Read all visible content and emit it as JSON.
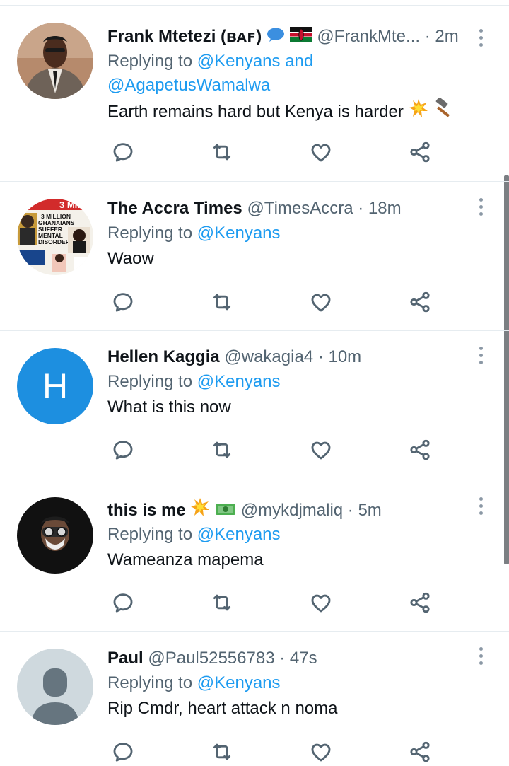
{
  "colors": {
    "link": "#1d9bf0",
    "secondary": "#536471",
    "divider": "#e6ecf0",
    "text": "#0f1419"
  },
  "replying_prefix": "Replying to",
  "tweets": [
    {
      "name": "Frank Mtetezi (ʙᴀꜰ)",
      "handle": "@FrankMte...",
      "time": "· 2m",
      "reply_line1": "@Kenyans and",
      "reply_line2": "@AgapetusWamalwa",
      "text": "Earth remains hard but Kenya is harder",
      "icons": [
        "speech-bubble-emoji",
        "kenya-flag-emoji",
        "collision-emoji",
        "hammer-emoji"
      ]
    },
    {
      "name": "The Accra Times",
      "handle": "@TimesAccra",
      "time": "· 18m",
      "reply": "@Kenyans",
      "text": "Waow",
      "avatar_text": [
        "3 MILLION",
        "GHANAIANS",
        "SUFFER",
        "MENTAL",
        "DISORDER"
      ]
    },
    {
      "name": "Hellen Kaggia",
      "handle": "@wakagia4",
      "time": "· 10m",
      "reply": "@Kenyans",
      "text": "What is this now",
      "avatar_letter": "H"
    },
    {
      "name": "this is me",
      "handle": "@mykdjmaliq",
      "time": "· 5m",
      "reply": "@Kenyans",
      "text": "Wameanza mapema",
      "icons": [
        "collision-emoji",
        "dollar-banknote-emoji"
      ]
    },
    {
      "name": "Paul",
      "handle": "@Paul52556783",
      "time": "· 47s",
      "reply": "@Kenyans",
      "text": "Rip Cmdr, heart attack n noma"
    }
  ]
}
